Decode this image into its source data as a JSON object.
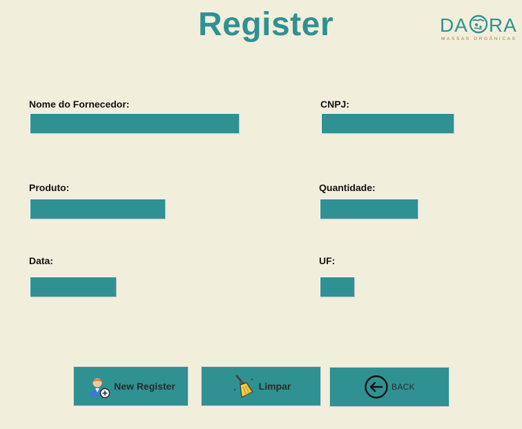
{
  "header": {
    "title": "Register"
  },
  "logo": {
    "brand_left": "DA",
    "brand_right": "RA",
    "tagline": "MASSAS ORGÂNICAS"
  },
  "form": {
    "supplier_label": "Nome do Fornecedor:",
    "supplier_value": "",
    "cnpj_label": "CNPJ:",
    "cnpj_value": "",
    "product_label": "Produto:",
    "product_value": "",
    "quantity_label": "Quantidade:",
    "quantity_value": "",
    "date_label": "Data:",
    "date_value": "",
    "uf_label": "UF:",
    "uf_value": ""
  },
  "buttons": {
    "new_register": {
      "label": "New Register",
      "icon": "add-user-icon"
    },
    "clear": {
      "label": "Limpar",
      "icon": "broom-icon"
    },
    "back": {
      "label": "BACK",
      "icon": "back-arrow-icon"
    }
  },
  "colors": {
    "background": "#f2eedc",
    "accent": "#2f9191",
    "logo_tagline": "#a0783a"
  }
}
